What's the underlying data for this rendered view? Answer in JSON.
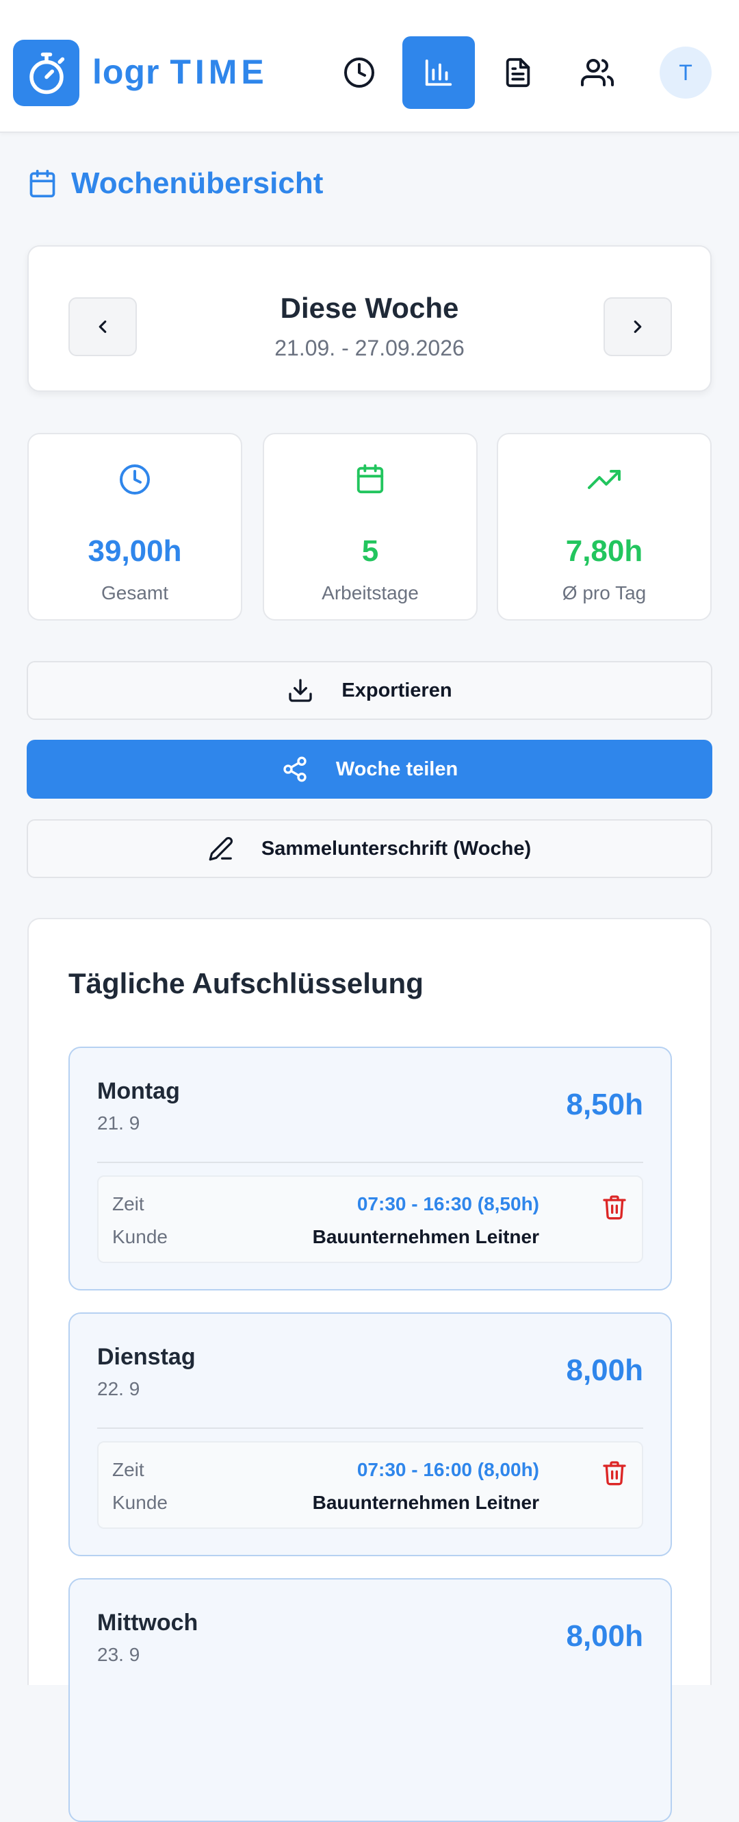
{
  "app": {
    "logo_word1": "logr",
    "logo_word2": "TIME",
    "avatar_initial": "T"
  },
  "nav": {
    "items": [
      {
        "icon": "clock-icon",
        "active": false
      },
      {
        "icon": "bar-chart-icon",
        "active": true
      },
      {
        "icon": "document-icon",
        "active": false
      },
      {
        "icon": "users-icon",
        "active": false
      }
    ]
  },
  "page": {
    "title": "Wochenübersicht"
  },
  "week": {
    "title": "Diese Woche",
    "range": "21.09. - 27.09.2026"
  },
  "stats": [
    {
      "value": "39,00h",
      "label": "Gesamt",
      "icon": "clock-icon",
      "color": "#2f86eb"
    },
    {
      "value": "5",
      "label": "Arbeitstage",
      "icon": "calendar-icon",
      "color": "#22c55e"
    },
    {
      "value": "7,80h",
      "label": "Ø pro Tag",
      "icon": "trending-up-icon",
      "color": "#22c55e"
    }
  ],
  "actions": {
    "export": "Exportieren",
    "share": "Woche teilen",
    "signature": "Sammelunterschrift (Woche)"
  },
  "breakdown": {
    "title": "Tägliche Aufschlüsselung",
    "time_label": "Zeit",
    "client_label": "Kunde",
    "days": [
      {
        "name": "Montag",
        "date": "21. 9",
        "hours": "8,50h",
        "time": "07:30 - 16:30 (8,50h)",
        "client": "Bauunternehmen Leitner"
      },
      {
        "name": "Dienstag",
        "date": "22. 9",
        "hours": "8,00h",
        "time": "07:30 - 16:00 (8,00h)",
        "client": "Bauunternehmen Leitner"
      },
      {
        "name": "Mittwoch",
        "date": "23. 9",
        "hours": "8,00h",
        "time": "",
        "client": ""
      }
    ]
  },
  "colors": {
    "accent": "#2f86eb",
    "success": "#22c55e",
    "danger": "#dc2626"
  }
}
